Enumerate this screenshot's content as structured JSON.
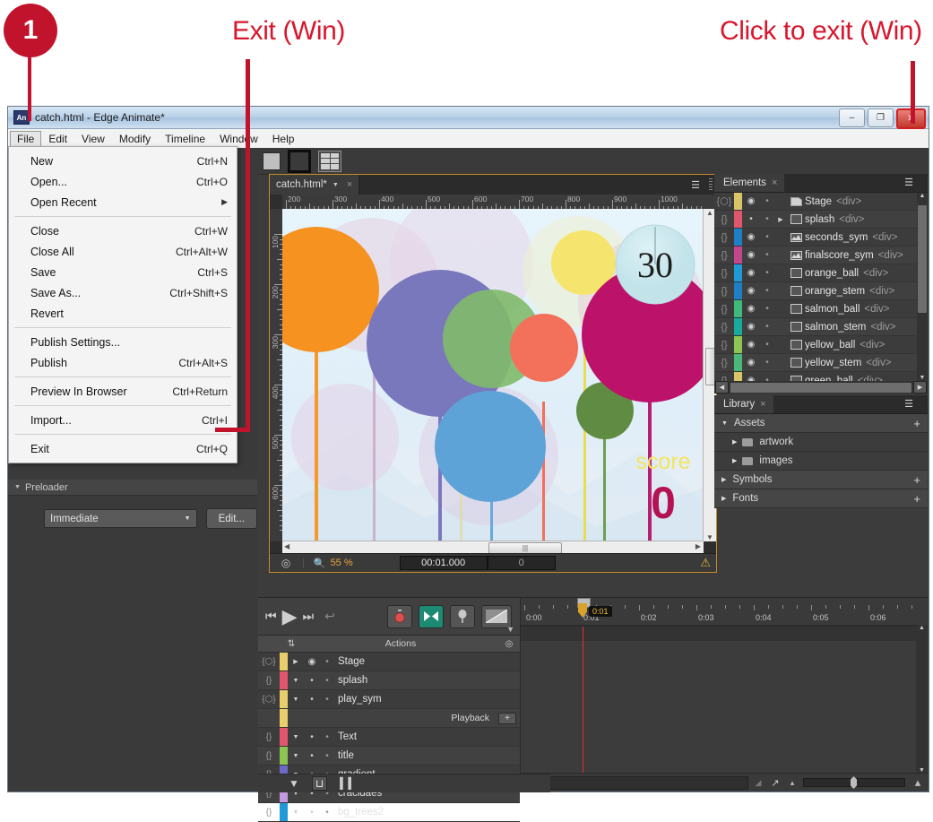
{
  "annotations": {
    "badge_number": "1",
    "label_exit": "Exit (Win)",
    "label_click_exit": "Click to exit (Win)",
    "accent_color": "#c1132b"
  },
  "window": {
    "app_icon": "An",
    "title": "catch.html - Edge Animate*",
    "minimize": "–",
    "restore": "❐",
    "close": "✕"
  },
  "menubar": {
    "items": [
      "File",
      "Edit",
      "View",
      "Modify",
      "Timeline",
      "Window",
      "Help"
    ],
    "active": "File"
  },
  "file_menu": {
    "groups": [
      [
        {
          "label": "New",
          "shortcut": "Ctrl+N"
        },
        {
          "label": "Open...",
          "shortcut": "Ctrl+O"
        },
        {
          "label": "Open Recent",
          "shortcut": "",
          "submenu": true
        }
      ],
      [
        {
          "label": "Close",
          "shortcut": "Ctrl+W"
        },
        {
          "label": "Close All",
          "shortcut": "Ctrl+Alt+W"
        },
        {
          "label": "Save",
          "shortcut": "Ctrl+S"
        },
        {
          "label": "Save As...",
          "shortcut": "Ctrl+Shift+S"
        },
        {
          "label": "Revert",
          "shortcut": ""
        }
      ],
      [
        {
          "label": "Publish Settings...",
          "shortcut": ""
        },
        {
          "label": "Publish",
          "shortcut": "Ctrl+Alt+S"
        }
      ],
      [
        {
          "label": "Preview In Browser",
          "shortcut": "Ctrl+Return"
        }
      ],
      [
        {
          "label": "Import...",
          "shortcut": "Ctrl+I"
        }
      ],
      [
        {
          "label": "Exit",
          "shortcut": "Ctrl+Q"
        }
      ]
    ]
  },
  "left_panel": {
    "preloader_title": "Preloader",
    "preloader_value": "Immediate",
    "edit_button": "Edit..."
  },
  "stage": {
    "tab_label": "catch.html*",
    "tab_close": "×",
    "h_ruler_ticks": [
      "200",
      "300",
      "400",
      "500",
      "600",
      "700",
      "800",
      "900",
      "1000"
    ],
    "v_ruler_ticks": [
      "100",
      "200",
      "300",
      "400",
      "500",
      "600"
    ],
    "zoom": "55 %",
    "time_value": "00:01.000",
    "frame_value": "0",
    "artwork_score_label": "score",
    "artwork_score_value": "0",
    "artwork_timer_value": "30"
  },
  "elements_panel": {
    "tab_label": "Elements",
    "tab_close": "×",
    "rows": [
      {
        "name": "Stage",
        "tag": "<div>",
        "color": "#d9c566",
        "eye": true,
        "type": "stage",
        "curly": "{⬡}"
      },
      {
        "name": "splash",
        "tag": "<div>",
        "color": "#e2566d",
        "eye": false,
        "type": "div",
        "curly": "{}"
      },
      {
        "name": "seconds_sym",
        "tag": "<div>",
        "color": "#1f7fc4",
        "eye": true,
        "type": "symbol",
        "curly": "{}"
      },
      {
        "name": "finalscore_sym",
        "tag": "<div>",
        "color": "#c2478c",
        "eye": true,
        "type": "symbol",
        "curly": "{}"
      },
      {
        "name": "orange_ball",
        "tag": "<div>",
        "color": "#1f9ad6",
        "eye": true,
        "type": "div",
        "curly": "{}"
      },
      {
        "name": "orange_stem",
        "tag": "<div>",
        "color": "#1f7fc4",
        "eye": true,
        "type": "div",
        "curly": "{}"
      },
      {
        "name": "salmon_ball",
        "tag": "<div>",
        "color": "#3fba7a",
        "eye": true,
        "type": "div",
        "curly": "{}"
      },
      {
        "name": "salmon_stem",
        "tag": "<div>",
        "color": "#16ab9a",
        "eye": true,
        "type": "div",
        "curly": "{}"
      },
      {
        "name": "yellow_ball",
        "tag": "<div>",
        "color": "#8dc452",
        "eye": true,
        "type": "div",
        "curly": "{}"
      },
      {
        "name": "yellow_stem",
        "tag": "<div>",
        "color": "#4bb87a",
        "eye": true,
        "type": "div",
        "curly": "{}"
      },
      {
        "name": "green_ball",
        "tag": "<div>",
        "color": "#d9c566",
        "eye": true,
        "type": "div",
        "curly": "{}"
      }
    ]
  },
  "library_panel": {
    "tab_label": "Library",
    "tab_close": "×",
    "sections": [
      {
        "label": "Assets",
        "expanded": true,
        "plus": "+",
        "children": [
          {
            "label": "artwork"
          },
          {
            "label": "images"
          }
        ]
      },
      {
        "label": "Symbols",
        "expanded": false,
        "plus": "+",
        "children": []
      },
      {
        "label": "Fonts",
        "expanded": false,
        "plus": "+",
        "children": []
      }
    ]
  },
  "timeline": {
    "playback": {
      "prev": "⏮",
      "play": "▶",
      "next": "⏭",
      "undo": "↩"
    },
    "tools": [
      "stopwatch-icon",
      "easing-icon",
      "pin-icon",
      "gradient-icon"
    ],
    "col_actions": "Actions",
    "layers": [
      {
        "name": "Stage",
        "color": "#e8cf6b",
        "curly": "{⬡}",
        "tri": "▶",
        "eye": true
      },
      {
        "name": "splash",
        "color": "#e2566d",
        "curly": "{}",
        "tri": "▼",
        "eye": false
      },
      {
        "name": "play_sym",
        "color": "#e8cf6b",
        "curly": "{⬡}",
        "tri": "▼",
        "eye": false
      },
      {
        "name": "Playback",
        "color": "#e8cf6b",
        "curly": "",
        "tri": "",
        "eye": false,
        "sub": true
      },
      {
        "name": "Text",
        "color": "#e2566d",
        "curly": "{}",
        "tri": "▼",
        "eye": false
      },
      {
        "name": "title",
        "color": "#8dc452",
        "curly": "{}",
        "tri": "▼",
        "eye": false
      },
      {
        "name": "gradient",
        "color": "#6b6bc4",
        "curly": "{}",
        "tri": "▼",
        "eye": false
      },
      {
        "name": "cracidaes",
        "color": "#c49ae0",
        "curly": "{}",
        "tri": "▼",
        "eye": false
      },
      {
        "name": "bg_trees2",
        "color": "#1f9ad6",
        "curly": "{}",
        "tri": "▼",
        "eye": false
      }
    ],
    "ruler_labels": [
      "0:00",
      "0:01",
      "0:02",
      "0:03",
      "0:04",
      "0:05",
      "0:06"
    ],
    "playhead_time": "0:01",
    "footer_icons": [
      "filter-icon",
      "snap-icon",
      "columns-icon"
    ]
  }
}
